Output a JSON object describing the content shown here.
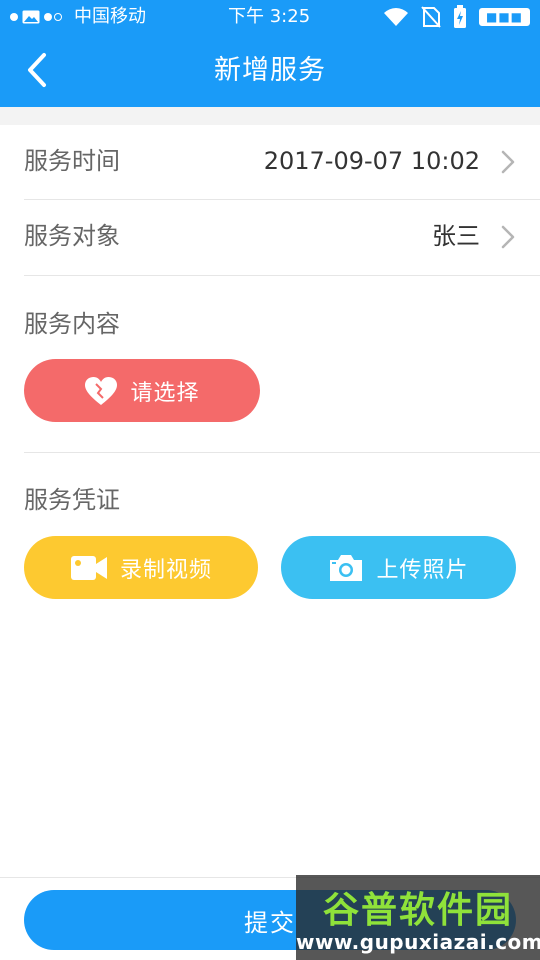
{
  "status_bar": {
    "carrier": "中国移动",
    "time": "下午 3:25"
  },
  "nav": {
    "title": "新增服务",
    "back_icon": "chevron-left-icon"
  },
  "form": {
    "service_time": {
      "label": "服务时间",
      "value": "2017-09-07  10:02"
    },
    "service_target": {
      "label": "服务对象",
      "value": "张三"
    },
    "service_content": {
      "label": "服务内容",
      "button_label": "请选择",
      "icon": "heart-icon"
    },
    "service_proof": {
      "label": "服务凭证",
      "record_label": "录制视频",
      "record_icon": "video-camera-icon",
      "upload_label": "上传照片",
      "upload_icon": "camera-icon"
    }
  },
  "submit": {
    "label": "提交"
  },
  "watermark": {
    "main": "谷普软件园",
    "sub": "www.gupuxiazai.com"
  },
  "colors": {
    "primary": "#1a9bf8",
    "red_button": "#f46a6a",
    "yellow_button": "#fdc930",
    "blue_button": "#3bc0f2"
  }
}
